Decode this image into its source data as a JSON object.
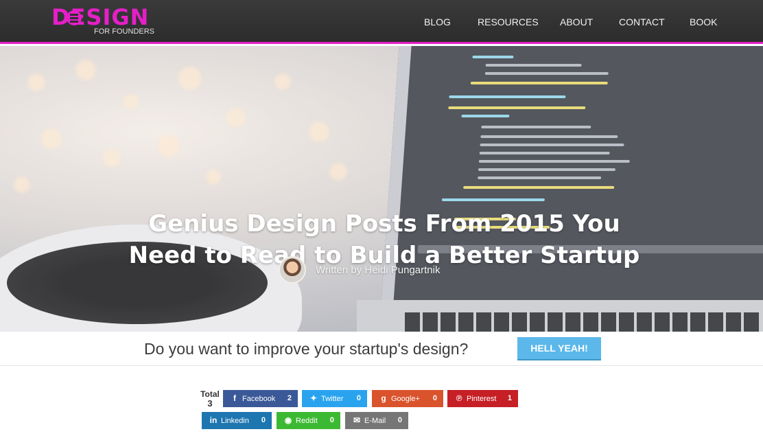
{
  "header": {
    "logo_main": "DESIGN",
    "logo_sub": "FOR FOUNDERS",
    "nav": [
      {
        "label": "BLOG"
      },
      {
        "label": "RESOURCES"
      },
      {
        "label": "ABOUT"
      },
      {
        "label": "CONTACT"
      },
      {
        "label": "BOOK"
      }
    ]
  },
  "hero": {
    "title_line1": "Genius Design Posts From 2015 You",
    "title_line2": "Need to Read to Build a Better Startup",
    "author": "Written by Heidi Pungartnik"
  },
  "cta": {
    "text": "Do you want to improve your startup's design?",
    "button": "HELL YEAH!"
  },
  "share": {
    "total_label": "Total",
    "total_count": "3",
    "buttons": [
      {
        "label": "Facebook",
        "count": "2",
        "icon": "facebook-icon"
      },
      {
        "label": "Twitter",
        "count": "0",
        "icon": "twitter-icon"
      },
      {
        "label": "Google+",
        "count": "0",
        "icon": "google-plus-icon"
      },
      {
        "label": "Pinterest",
        "count": "1",
        "icon": "pinterest-icon"
      },
      {
        "label": "Linkedin",
        "count": "0",
        "icon": "linkedin-icon"
      },
      {
        "label": "Reddit",
        "count": "0",
        "icon": "reddit-icon"
      },
      {
        "label": "E-Mail",
        "count": "0",
        "icon": "email-icon"
      }
    ]
  },
  "colors": {
    "brand_magenta": "#e51fc8",
    "header_bg": "#2f2f2f",
    "cta_button": "#5cb8ea"
  }
}
